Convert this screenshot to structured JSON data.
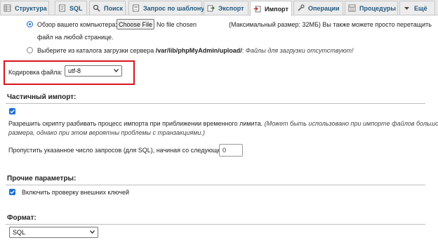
{
  "tabs": [
    {
      "label": "Структура",
      "icon": "structure-icon"
    },
    {
      "label": "SQL",
      "icon": "sql-icon"
    },
    {
      "label": "Поиск",
      "icon": "search-icon"
    },
    {
      "label": "Запрос по шаблону",
      "icon": "query-icon"
    },
    {
      "label": "Экспорт",
      "icon": "export-icon"
    },
    {
      "label": "Импорт",
      "icon": "import-icon",
      "active": true
    },
    {
      "label": "Операции",
      "icon": "operations-icon"
    },
    {
      "label": "Процедуры",
      "icon": "routines-icon"
    },
    {
      "label": "Ещё",
      "icon": "chevron-down-icon"
    }
  ],
  "upload": {
    "browse_label": "Обзор вашего компьютера:",
    "choose_button": "Choose File",
    "no_file": "No file chosen",
    "max_size": "(Максимальный размер: 32МБ) Вы также можете просто перетащить",
    "drag_drop_cont": "файл на любой странице.",
    "server_label": "Выберите из каталога загрузки сервера",
    "server_path": "/var/lib/phpMyAdmin/upload/",
    "server_colon": ":",
    "server_note": "Файлы для загрузки отсутствуют!"
  },
  "encoding": {
    "label": "Кодировка файла:",
    "value": "utf-8"
  },
  "partial": {
    "title": "Частичный импорт:",
    "allow_interrupt": "Разрешить скрипту разбивать процесс импорта при приближении временного лимита.",
    "allow_interrupt_note_1": "(Может быть использовано при импорте файлов большого",
    "allow_interrupt_note_2": "размера, однако при этом вероятны проблемы с транзакциями.)",
    "skip_label": "Пропустить указанное число запросов (для SQL), начиная со следующего:",
    "skip_value": "0"
  },
  "other": {
    "title": "Прочие параметры:",
    "fk_checks": "Включить проверку внешних ключей"
  },
  "format": {
    "title": "Формат:",
    "value": "SQL"
  },
  "colors": {
    "accent": "#1a6fd6",
    "highlight": "#d8141c",
    "tab_text": "#235a81"
  }
}
